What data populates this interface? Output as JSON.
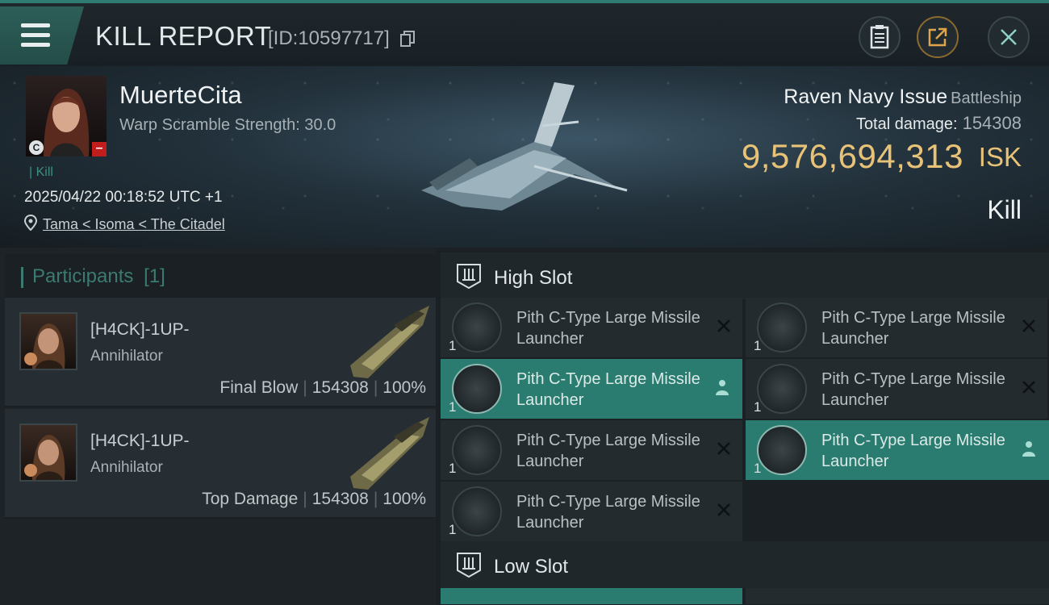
{
  "header": {
    "title": "KILL REPORT",
    "report_id": "[ID:10597717]",
    "icons": [
      "menu-icon",
      "copy-icon",
      "clipboard-icon",
      "share-icon",
      "close-icon"
    ]
  },
  "victim": {
    "name": "MuerteCita",
    "subtitle": "Warp Scramble Strength: 30.0",
    "tag": "Kill",
    "corp_badge": "C",
    "standing_badge": "–",
    "datetime": "2025/04/22 00:18:52 UTC +1",
    "location": "Tama < Isoma < The Citadel"
  },
  "ship": {
    "name": "Raven Navy Issue",
    "class": "Battleship",
    "total_damage_label": "Total damage:",
    "total_damage": "154308",
    "isk_value": "9,576,694,313",
    "isk_unit": "ISK",
    "result": "Kill"
  },
  "participants": {
    "label": "Participants",
    "count": "[1]",
    "rows": [
      {
        "name": "[H4CK]-1UP-",
        "ship": "Annihilator",
        "role": "Final Blow",
        "damage": "154308",
        "percent": "100%"
      },
      {
        "name": "[H4CK]-1UP-",
        "ship": "Annihilator",
        "role": "Top Damage",
        "damage": "154308",
        "percent": "100%"
      }
    ]
  },
  "slots": {
    "high": {
      "title": "High Slot",
      "items": [
        {
          "qty": "1",
          "name": "Pith C-Type Large Missile Launcher",
          "active": false
        },
        {
          "qty": "1",
          "name": "Pith C-Type Large Missile Launcher",
          "active": false
        },
        {
          "qty": "1",
          "name": "Pith C-Type Large Missile Launcher",
          "active": true
        },
        {
          "qty": "1",
          "name": "Pith C-Type Large Missile Launcher",
          "active": false
        },
        {
          "qty": "1",
          "name": "Pith C-Type Large Missile Launcher",
          "active": false
        },
        {
          "qty": "1",
          "name": "Pith C-Type Large Missile Launcher",
          "active": true
        },
        {
          "qty": "1",
          "name": "Pith C-Type Large Missile Launcher",
          "active": false
        }
      ]
    },
    "low": {
      "title": "Low Slot"
    }
  },
  "colors": {
    "accent": "#2a7c70",
    "isk": "#e8c277",
    "standing": "#c21d1d"
  }
}
